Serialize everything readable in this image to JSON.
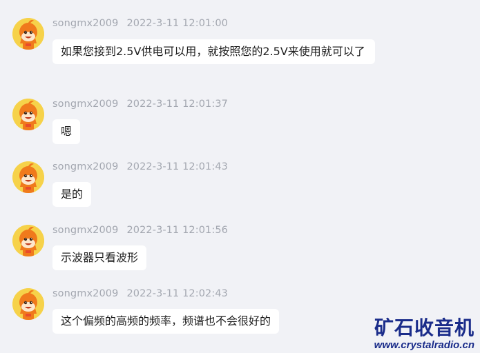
{
  "messages": [
    {
      "user": "songmx2009",
      "time": "2022-3-11 12:01:00",
      "text": "如果您接到2.5V供电可以用，就按照您的2.5V来使用就可以了"
    },
    {
      "user": "songmx2009",
      "time": "2022-3-11 12:01:37",
      "text": "嗯"
    },
    {
      "user": "songmx2009",
      "time": "2022-3-11 12:01:43",
      "text": "是的"
    },
    {
      "user": "songmx2009",
      "time": "2022-3-11 12:01:56",
      "text": "示波器只看波形"
    },
    {
      "user": "songmx2009",
      "time": "2022-3-11 12:02:43",
      "text": "这个偏频的高频的频率，频谱也不会很好的"
    }
  ],
  "watermark": {
    "title": "矿石收音机",
    "url": "www.crystalradio.cn"
  },
  "colors": {
    "background": "#f1f2f6",
    "bubble": "#ffffff",
    "meta_text": "#a3a7b0",
    "watermark": "#1a2c8a",
    "avatar_bg": "#f6d24a",
    "avatar_character": "#f07a1c"
  },
  "icons": {
    "avatar": "orange-cartoon-avatar-icon"
  }
}
